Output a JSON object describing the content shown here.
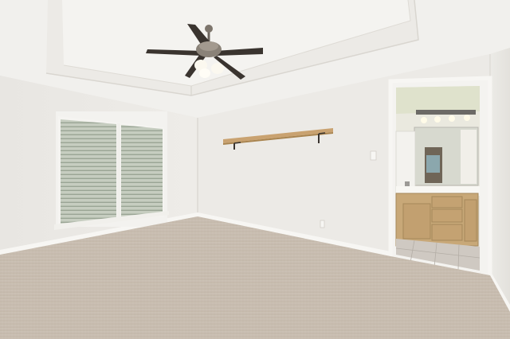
{
  "scene": {
    "subject": "empty-bedroom-interior",
    "colors": {
      "wall": "#ebe9e5",
      "ceiling": "#f2f1ee",
      "carpet": "#c8bdb0",
      "cabinet": "#c8a878",
      "shelf": "#c9a270",
      "fan_blade": "#3a342f",
      "window_glass": "#b7c2b0",
      "tile": "#cfc9c2"
    },
    "icons": [
      "ceiling-fan-icon",
      "light-fixture-icon",
      "outlet-icon",
      "light-switch-icon"
    ]
  }
}
